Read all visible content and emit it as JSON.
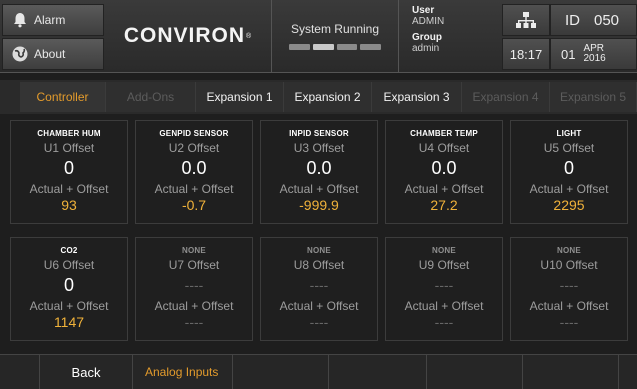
{
  "header": {
    "alarm_label": "Alarm",
    "about_label": "About",
    "brand": "CONVIRON",
    "brand_mark": "®",
    "system_status": "System Running",
    "user_label": "User",
    "user_value": "ADMIN",
    "group_label": "Group",
    "group_value": "admin",
    "id_label": "ID",
    "id_value": "050",
    "time": "18:17",
    "day": "01",
    "month": "APR",
    "year": "2016",
    "icons": {
      "alarm": "bell-icon",
      "about": "globe-icon",
      "network": "network-icon"
    }
  },
  "tabs": [
    {
      "label": "Controller",
      "state": "active"
    },
    {
      "label": "Add-Ons",
      "state": "disabled"
    },
    {
      "label": "Expansion 1",
      "state": "enabled"
    },
    {
      "label": "Expansion 2",
      "state": "enabled"
    },
    {
      "label": "Expansion 3",
      "state": "enabled"
    },
    {
      "label": "Expansion 4",
      "state": "disabled"
    },
    {
      "label": "Expansion 5",
      "state": "disabled"
    }
  ],
  "cards": [
    {
      "name": "CHAMBER HUM",
      "offset_label": "U1 Offset",
      "offset": "0",
      "actual_label": "Actual + Offset",
      "actual": "93"
    },
    {
      "name": "GENPID SENSOR",
      "offset_label": "U2 Offset",
      "offset": "0.0",
      "actual_label": "Actual + Offset",
      "actual": "-0.7"
    },
    {
      "name": "INPID SENSOR",
      "offset_label": "U3 Offset",
      "offset": "0.0",
      "actual_label": "Actual + Offset",
      "actual": "-999.9"
    },
    {
      "name": "CHAMBER TEMP",
      "offset_label": "U4 Offset",
      "offset": "0.0",
      "actual_label": "Actual + Offset",
      "actual": "27.2"
    },
    {
      "name": "LIGHT",
      "offset_label": "U5 Offset",
      "offset": "0",
      "actual_label": "Actual + Offset",
      "actual": "2295"
    },
    {
      "name": "CO2",
      "offset_label": "U6 Offset",
      "offset": "0",
      "actual_label": "Actual + Offset",
      "actual": "1147"
    },
    {
      "name": "NONE",
      "offset_label": "U7 Offset",
      "offset": "----",
      "actual_label": "Actual + Offset",
      "actual": "----"
    },
    {
      "name": "NONE",
      "offset_label": "U8 Offset",
      "offset": "----",
      "actual_label": "Actual + Offset",
      "actual": "----"
    },
    {
      "name": "NONE",
      "offset_label": "U9 Offset",
      "offset": "----",
      "actual_label": "Actual + Offset",
      "actual": "----"
    },
    {
      "name": "NONE",
      "offset_label": "U10 Offset",
      "offset": "----",
      "actual_label": "Actual + Offset",
      "actual": "----"
    }
  ],
  "footer": {
    "back_label": "Back",
    "section_label": "Analog Inputs"
  },
  "colors": {
    "accent": "#e39b2c",
    "value_highlight": "#f0b23a",
    "disabled": "#5c5c5c"
  }
}
